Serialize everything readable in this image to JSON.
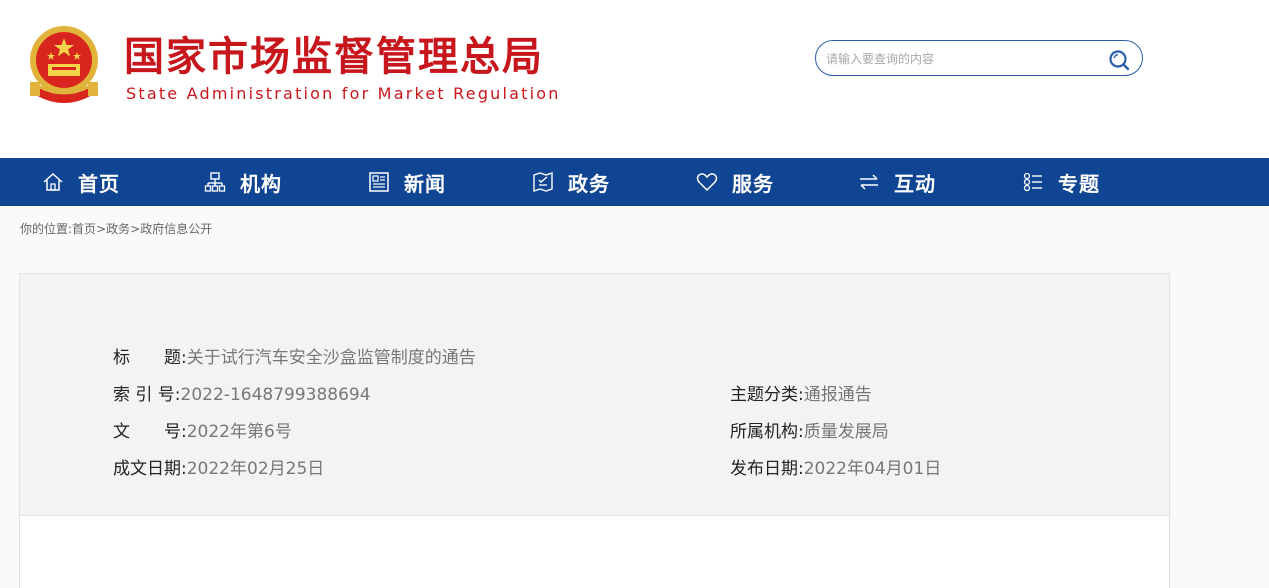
{
  "header": {
    "title_cn": "国家市场监督管理总局",
    "title_en": "State Administration for Market Regulation",
    "emblem_icon": "national-emblem-icon",
    "brand_color": "#c8161d"
  },
  "search": {
    "placeholder": "请输入要查询的内容",
    "icon": "search-icon"
  },
  "nav": {
    "bg_color": "#0f4592",
    "items": [
      {
        "label": "首页",
        "icon": "home-icon"
      },
      {
        "label": "机构",
        "icon": "org-chart-icon"
      },
      {
        "label": "新闻",
        "icon": "news-icon"
      },
      {
        "label": "政务",
        "icon": "government-affairs-icon"
      },
      {
        "label": "服务",
        "icon": "heart-icon"
      },
      {
        "label": "互动",
        "icon": "exchange-arrows-icon"
      },
      {
        "label": "专题",
        "icon": "topics-list-icon"
      }
    ]
  },
  "breadcrumb": {
    "prefix": "你的位置:",
    "items": [
      "首页",
      "政务",
      "政府信息公开"
    ],
    "sep": ">"
  },
  "doc": {
    "title_label": "标　　题:",
    "title_value": "关于试行汽车安全沙盒监管制度的通告",
    "index_label": "索 引 号:",
    "index_value": "2022-1648799388694",
    "category_label": "主题分类:",
    "category_value": "通报通告",
    "docno_label": "文　　号:",
    "docno_value": "2022年第6号",
    "org_label": "所属机构:",
    "org_value": "质量发展局",
    "created_label": "成文日期:",
    "created_value": "2022年02月25日",
    "published_label": "发布日期:",
    "published_value": "2022年04月01日"
  }
}
